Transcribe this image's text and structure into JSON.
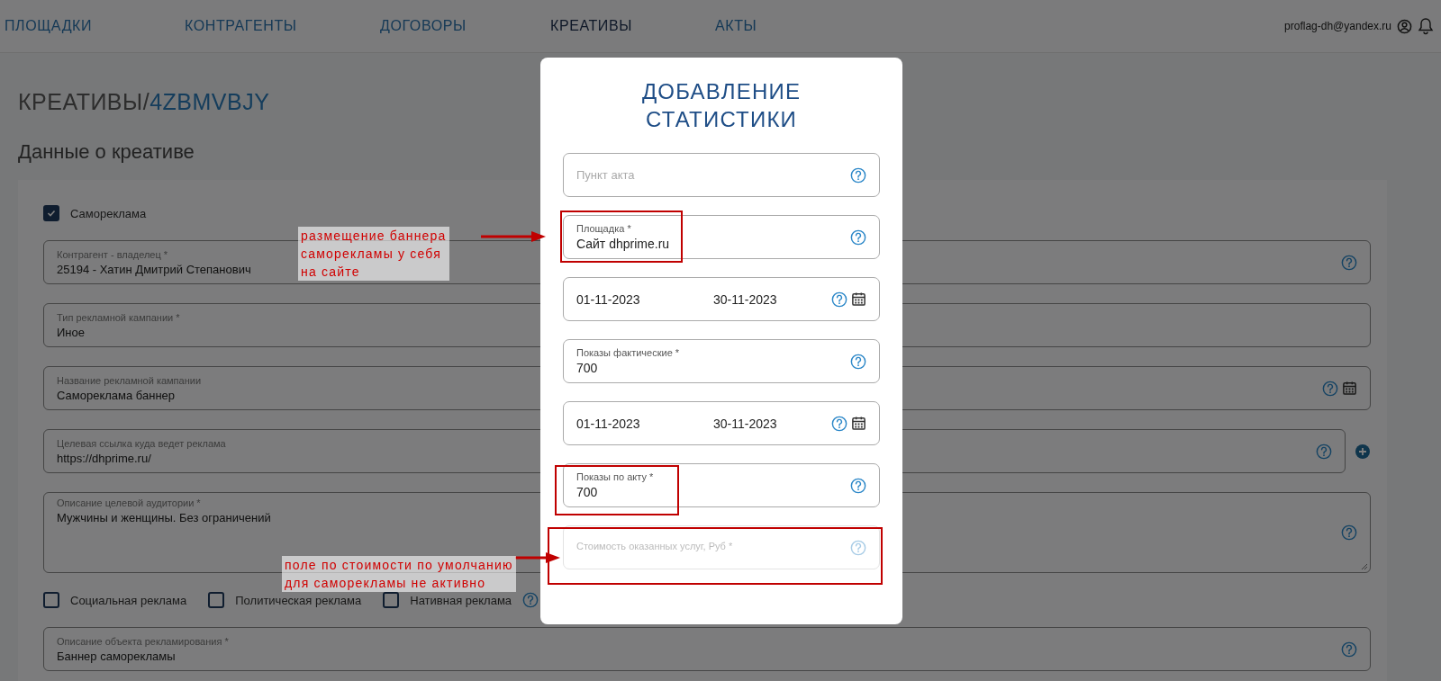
{
  "nav": {
    "items": [
      {
        "label": "ПЛОЩАДКИ",
        "selected": false
      },
      {
        "label": "КОНТРАГЕНТЫ",
        "selected": false
      },
      {
        "label": "ДОГОВОРЫ",
        "selected": false
      },
      {
        "label": "КРЕАТИВЫ",
        "selected": true
      },
      {
        "label": "АКТЫ",
        "selected": false
      }
    ],
    "user_email": "proflag-dh@yandex.ru"
  },
  "breadcrumb": {
    "section": "КРЕАТИВЫ/",
    "id": "4ZBMVBJY"
  },
  "section_title": "Данные о креативе",
  "self_ad": {
    "label": "Самореклама",
    "checked": true
  },
  "fields": [
    {
      "kind": "help",
      "label": "Контрагент - владелец *",
      "value": "25194 - Хатин Дмитрий Степанович"
    },
    {
      "kind": "plain",
      "label": "Тип рекламной кампании *",
      "value": "Иное"
    },
    {
      "kind": "date",
      "label": "Название рекламной кампании",
      "value": "Самореклама баннер"
    },
    {
      "kind": "link",
      "label": "Целевая ссылка куда ведет реклама",
      "value": "https://dhprime.ru/"
    },
    {
      "kind": "area",
      "label": "Описание целевой аудитории *",
      "value": "Мужчины и женщины. Без ограничений"
    }
  ],
  "ad_types": [
    {
      "label": "Социальная реклама",
      "checked": false
    },
    {
      "label": "Политическая реклама",
      "checked": false
    },
    {
      "label": "Нативная реклама",
      "checked": false
    }
  ],
  "object_field": {
    "label": "Описание объекта рекламирования *",
    "value": "Баннер саморекламы"
  },
  "modal": {
    "title": "ДОБАВЛЕНИЕ СТАТИСТИКИ",
    "fields": [
      {
        "kind": "empty",
        "placeholder": "Пункт акта",
        "disabled": false
      },
      {
        "kind": "value",
        "label": "Площадка *",
        "value": "Сайт dhprime.ru",
        "disabled": false
      },
      {
        "kind": "daterange",
        "from": "01-11-2023",
        "to": "30-11-2023",
        "disabled": false
      },
      {
        "kind": "value",
        "label": "Показы фактические *",
        "value": "700",
        "disabled": false
      },
      {
        "kind": "daterange",
        "from": "01-11-2023",
        "to": "30-11-2023",
        "disabled": false
      },
      {
        "kind": "value",
        "label": "Показы по акту *",
        "value": "700",
        "disabled": false
      },
      {
        "kind": "empty",
        "label": "Стоимость оказанных услуг, Руб *",
        "disabled": true
      }
    ]
  },
  "annotations": [
    {
      "text": "размещение баннера\nсаморекламы у себя\nна сайте"
    },
    {
      "text": "поле по стоимости по умолчанию\nдля саморекламы не активно"
    }
  ]
}
